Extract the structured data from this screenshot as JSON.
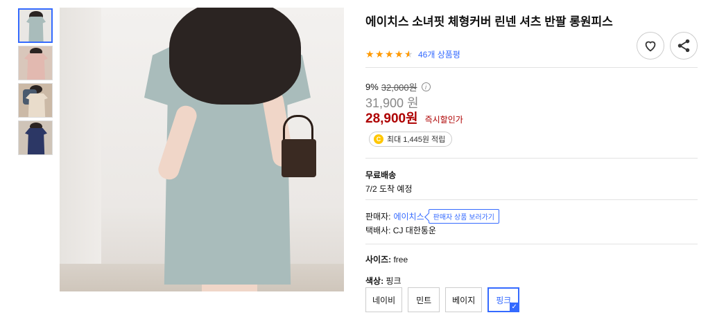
{
  "thumbnails": [
    {
      "alt": "mint dress thumbnail",
      "color": "#a9bcbb",
      "bg": "#e9e7e4",
      "active": true
    },
    {
      "alt": "pink dress thumbnail",
      "color": "#e2b9b0",
      "bg": "#d9c7bb"
    },
    {
      "alt": "beige dress thumbnail",
      "color": "#d7c2a8",
      "bg": "#cbb9a6"
    },
    {
      "alt": "navy dress thumbnail",
      "color": "#2c3765",
      "bg": "#cfc4b8"
    }
  ],
  "product": {
    "title": "에이치스 소녀핏 체형커버 린넨 셔츠 반팔 롱원피스",
    "rating": 4.5,
    "review_count": "46개 상품평"
  },
  "price": {
    "discount_rate": "9%",
    "original": "32,000원",
    "info_icon": "i",
    "sale": "31,900 원",
    "final": "28,900원",
    "instant_label": "즉시할인가"
  },
  "cash": {
    "coin_icon": "C",
    "text": "최대 1,445원 적립"
  },
  "shipping": {
    "title": "무료배송",
    "date": "7/2 도착 예정"
  },
  "seller": {
    "label": "판매자:",
    "name": "에이치스",
    "button": "판매자 상품 보러가기",
    "courier": "택배사: CJ 대한통운"
  },
  "size": {
    "label": "사이즈:",
    "value": "free"
  },
  "color_option": {
    "label": "색상:",
    "value": "핑크",
    "options": [
      {
        "label": "네이비",
        "selected": false
      },
      {
        "label": "민트",
        "selected": false
      },
      {
        "label": "베이지",
        "selected": false
      },
      {
        "label": "핑크",
        "selected": true
      }
    ]
  },
  "icons": {
    "wishlist": "heart-icon",
    "share": "share-icon",
    "check": "✓"
  },
  "colors": {
    "accent": "#346aff",
    "price_red": "#ae0000",
    "star": "#ff9900"
  }
}
